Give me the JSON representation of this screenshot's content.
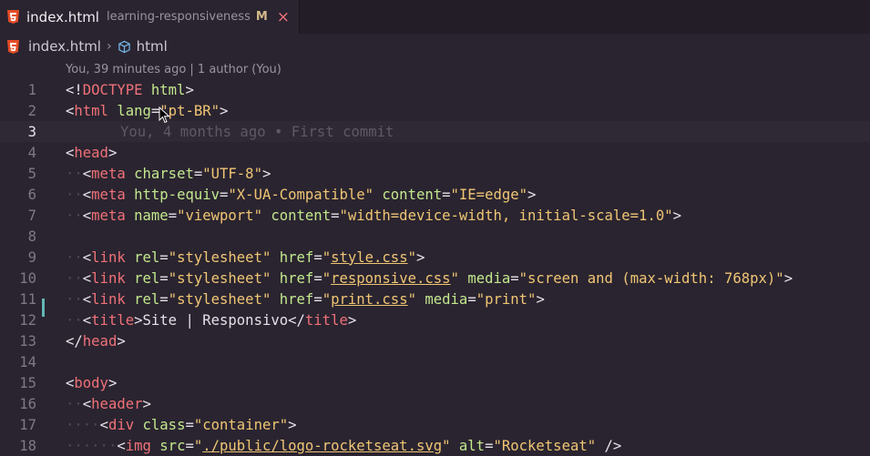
{
  "tab": {
    "filename": "index.html",
    "folder": "learning-responsiveness",
    "status": "M",
    "close": "×"
  },
  "breadcrumb": {
    "file": "index.html",
    "separator": "›",
    "symbol": "html"
  },
  "blame": {
    "header": "You, 39 minutes ago | 1 author (You)",
    "inline": "You, 4 months ago • First commit"
  },
  "colors": {
    "background": "#2a2430",
    "tag": "#f07178",
    "attribute": "#c3e88d",
    "string": "#f0c674",
    "modified_bar": "#64b5b5",
    "html5_icon": "#e44d26"
  },
  "lines": [
    {
      "n": "1",
      "t": "<!DOCTYPE html>"
    },
    {
      "n": "2",
      "t": "<html lang=\"pt-BR\">"
    },
    {
      "n": "3",
      "t": ""
    },
    {
      "n": "4",
      "t": "<head>"
    },
    {
      "n": "5",
      "t": "  <meta charset=\"UTF-8\">"
    },
    {
      "n": "6",
      "t": "  <meta http-equiv=\"X-UA-Compatible\" content=\"IE=edge\">"
    },
    {
      "n": "7",
      "t": "  <meta name=\"viewport\" content=\"width=device-width, initial-scale=1.0\">"
    },
    {
      "n": "8",
      "t": ""
    },
    {
      "n": "9",
      "t": "  <link rel=\"stylesheet\" href=\"style.css\">"
    },
    {
      "n": "10",
      "t": "  <link rel=\"stylesheet\" href=\"responsive.css\" media=\"screen and (max-width: 768px)\">"
    },
    {
      "n": "11",
      "t": "  <link rel=\"stylesheet\" href=\"print.css\" media=\"print\">"
    },
    {
      "n": "12",
      "t": "  <title>Site | Responsivo</title>"
    },
    {
      "n": "13",
      "t": "</head>"
    },
    {
      "n": "14",
      "t": ""
    },
    {
      "n": "15",
      "t": "<body>"
    },
    {
      "n": "16",
      "t": "  <header>"
    },
    {
      "n": "17",
      "t": "    <div class=\"container\">"
    },
    {
      "n": "18",
      "t": "      <img src=\"./public/logo-rocketseat.svg\" alt=\"Rocketseat\" />"
    }
  ],
  "current_line": 3,
  "modified_line": 12
}
